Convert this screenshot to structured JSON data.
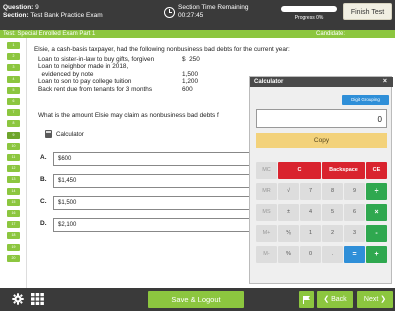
{
  "header": {
    "question_label": "Question:",
    "question_value": "9",
    "section_label": "Section:",
    "section_value": "Test Bank Practice Exam",
    "timer_title": "Section Time Remaining",
    "timer_value": "00:27:45",
    "progress_text": "Progress 0%",
    "progress_fraction": 0,
    "finish_label": "Finish Test"
  },
  "subheader": {
    "test_name": "Test: Special Enrolled Exam Part 1",
    "candidate_label": "Candidate:"
  },
  "nav": {
    "question_numbers": [
      "1",
      "2",
      "3",
      "4",
      "5",
      "6",
      "7",
      "8",
      "9",
      "10",
      "11",
      "12",
      "13",
      "14",
      "15",
      "16",
      "17",
      "18",
      "19",
      "20"
    ]
  },
  "question": {
    "stem": "Elsie, a cash-basis taxpayer, had the following nonbusiness bad debts for the current year:",
    "loans": [
      {
        "label": "Loan to sister-in-law to buy gifts, forgiven",
        "amount": "$  250"
      },
      {
        "label": "Loan to neighbor made in 2018,",
        "amount": ""
      },
      {
        "label": "  evidenced by note",
        "amount": "1,500"
      },
      {
        "label": "Loan to son to pay college tuition",
        "amount": "1,200"
      },
      {
        "label": "Back rent due from tenants for 3 months",
        "amount": "600"
      }
    ],
    "ask": "What is the amount Elsie may claim as nonbusiness bad debts f",
    "calculator_link": "Calculator",
    "choices": [
      {
        "letter": "A.",
        "text": "$600"
      },
      {
        "letter": "B.",
        "text": "$1,450"
      },
      {
        "letter": "C.",
        "text": "$1,500"
      },
      {
        "letter": "D.",
        "text": "$2,100"
      }
    ]
  },
  "calculator": {
    "title": "Calculator",
    "close": "×",
    "digit_grouping": "Digit Grouping",
    "display": "0",
    "copy": "Copy",
    "row1": [
      "MC",
      "C",
      "Backspace",
      "CE"
    ],
    "row2": [
      "MR",
      "√",
      "7",
      "8",
      "9",
      "÷"
    ],
    "row3": [
      "MS",
      "±",
      "4",
      "5",
      "6",
      "×"
    ],
    "row4": [
      "M+",
      "⅟ₓ",
      "1",
      "2",
      "3",
      "-"
    ],
    "row5": [
      "M-",
      "%",
      "0",
      ".",
      "=",
      "+"
    ]
  },
  "footer": {
    "save_label": "Save & Logout",
    "back_label": "❮ Back",
    "next_label": "Next ❯"
  }
}
